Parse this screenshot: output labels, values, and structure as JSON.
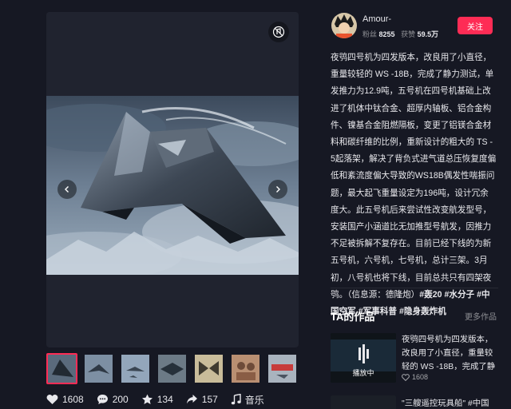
{
  "author": {
    "name": "Amour-",
    "fans_label": "粉丝",
    "fans_count": "8255",
    "likes_label": "获赞",
    "likes_count": "59.5万",
    "follow_label": "关注"
  },
  "description": {
    "text": "夜鸮四号机为四发版本，改良用了小直径，重量较轻的 WS -18B，完成了静力测试，单发推力为12.9吨，五号机在四号机基础上改进了机体中钛合金、超厚内轴板、铝合金构件、镍基合金阻燃隔板，变更了铝镁合金材料和碳纤维的比例，重新设计的粗大的 TS -5起落架，解决了背负式进气道总压恢复度偏低和紊流度偏大导致的WS18B偶发性喘振问题，最大起飞重量设定为196吨，设计冗余度大。此五号机后来尝试性改变航发型号，安装国产小涵道比无加推型号航发，因推力不足被拆解不复存在。目前已经下线的为新五号机，六号机，七号机，总计三架。3月初，八号机也将下线，目前总共只有四架夜鸮。（信息源：德隆炮）",
    "tags": [
      "#轰20",
      "#水分子",
      "#中国空军",
      "#军事科普",
      "#隐身轰炸机"
    ]
  },
  "actions": {
    "likes": "1608",
    "comments": "200",
    "favorites": "134",
    "shares": "157",
    "music": "音乐"
  },
  "works": {
    "title": "TA的作品",
    "more": "更多作品",
    "items": [
      {
        "title": "夜鸮四号机为四发版本，改良用了小直径，重量较轻的 WS -18B，完成了静力测试",
        "likes": "1608",
        "status": "播放中"
      },
      {
        "title": "\"三艘遥控玩具船\" #中国"
      }
    ]
  },
  "icons": {
    "mute": "mute-icon",
    "prev": "chevron-left-icon",
    "next": "chevron-right-icon",
    "like": "heart-icon",
    "comment": "comment-icon",
    "favorite": "star-icon",
    "share": "share-icon",
    "music": "music-note-icon"
  },
  "colors": {
    "background": "#161823",
    "accent": "#fe2c55"
  }
}
